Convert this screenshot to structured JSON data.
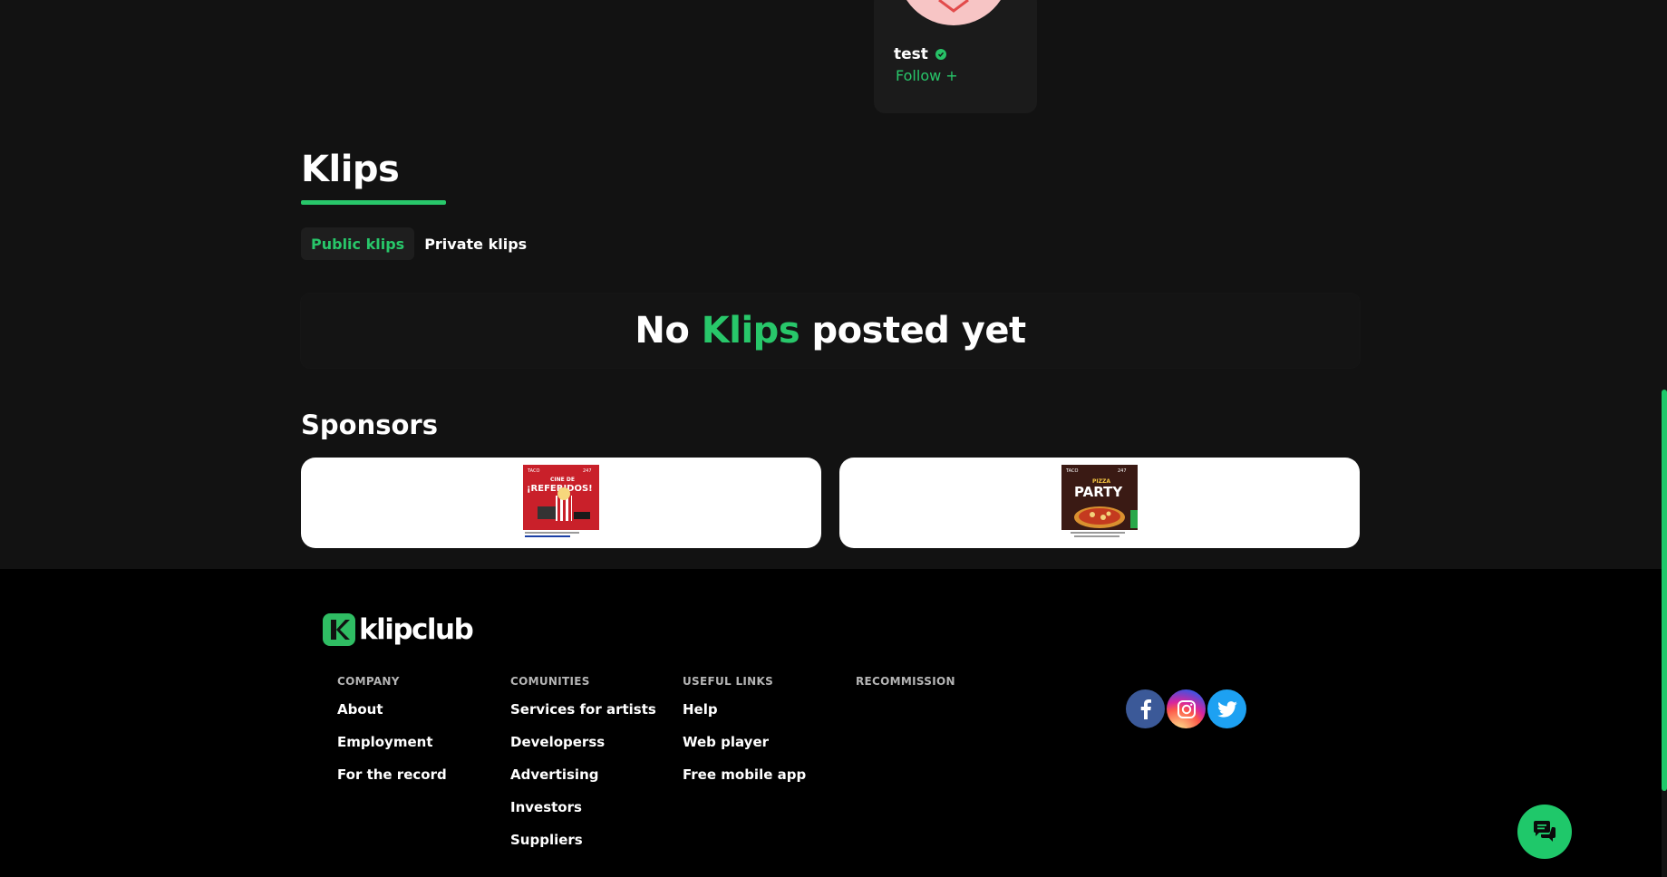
{
  "profile": {
    "name": "test",
    "follow_label": "Follow +"
  },
  "klips": {
    "title": "Klips",
    "tabs": [
      {
        "label": "Public klips",
        "active": true
      },
      {
        "label": "Private klips",
        "active": false
      }
    ],
    "empty_before": "No ",
    "empty_highlight": "Klips",
    "empty_after": " posted yet"
  },
  "sponsors": {
    "title": "Sponsors",
    "ads": [
      {
        "headline_small": "CINE DE",
        "headline": "¡REFERIDOS!",
        "brand_left": "TACO",
        "brand_right": "247"
      },
      {
        "headline_small": "PIZZA",
        "headline": "PARTY",
        "brand_left": "TACO",
        "brand_right": "247"
      }
    ]
  },
  "footer": {
    "logo_text": "klipclub",
    "columns": [
      {
        "heading": "COMPANY",
        "links": [
          "About",
          "Employment",
          "For the record"
        ]
      },
      {
        "heading": "COMUNITIES",
        "links": [
          "Services for artists",
          "Developerss",
          "Advertising",
          "Investors",
          "Suppliers"
        ]
      },
      {
        "heading": "USEFUL LINKS",
        "links": [
          "Help",
          "Web player",
          "Free mobile app"
        ]
      },
      {
        "heading": "RECOMMISSION",
        "links": []
      }
    ],
    "social": [
      "facebook-icon",
      "instagram-icon",
      "twitter-icon"
    ]
  },
  "colors": {
    "accent": "#28c76a",
    "background": "#121212",
    "footer": "#000000"
  }
}
